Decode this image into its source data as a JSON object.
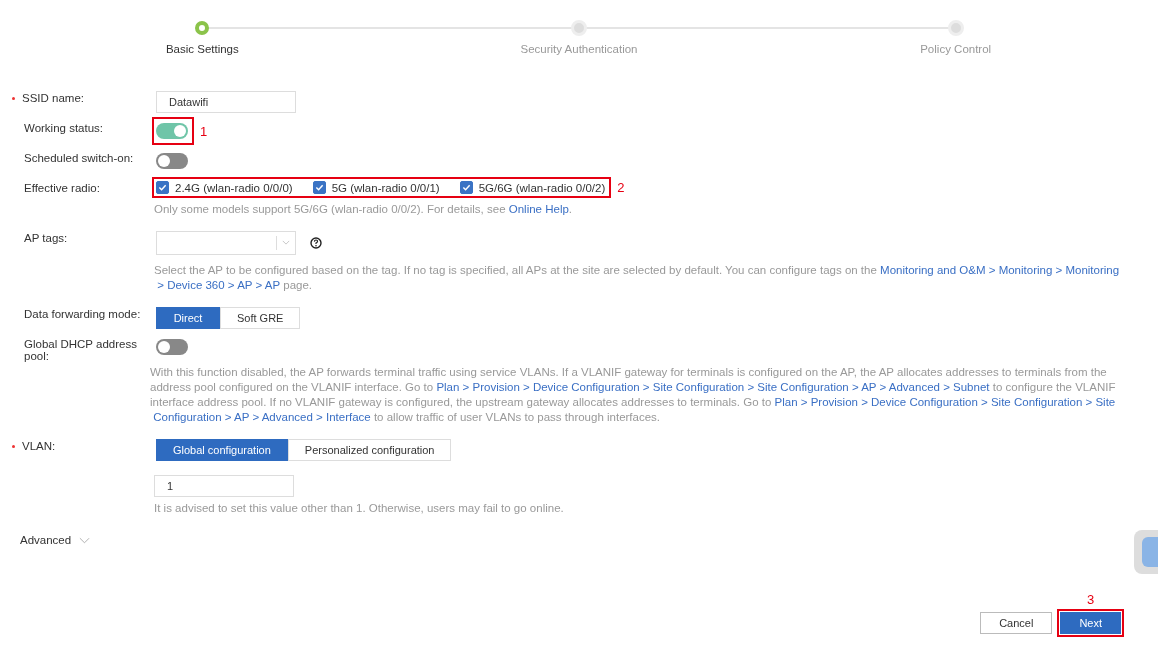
{
  "steps": [
    {
      "label": "Basic Settings",
      "selected": true
    },
    {
      "label": "Security Authentication",
      "selected": false
    },
    {
      "label": "Policy Control",
      "selected": false
    }
  ],
  "form": [
    {
      "kind": "text",
      "label": "SSID name:",
      "required": true,
      "value": "Datawifi"
    },
    {
      "kind": "toggle",
      "label": "Working status:",
      "required": false,
      "on": true,
      "annotation": "1"
    },
    {
      "kind": "toggle",
      "label": "Scheduled switch-on:",
      "required": false,
      "on": false
    },
    {
      "kind": "checks",
      "label": "Effective radio:",
      "required": false,
      "annotation": "2",
      "options": [
        {
          "label": "2.4G (wlan-radio 0/0/0)",
          "checked": true
        },
        {
          "label": "5G (wlan-radio 0/0/1)",
          "checked": true
        },
        {
          "label": "5G/6G (wlan-radio 0/0/2)",
          "checked": true
        }
      ],
      "help": [
        {
          "kind": "text",
          "text": "Only some models support 5G/6G (wlan-radio 0/0/2). For details, see "
        },
        {
          "kind": "link",
          "text": "Online Help"
        },
        {
          "kind": "text",
          "text": "."
        }
      ]
    },
    {
      "kind": "select",
      "label": "AP tags:",
      "required": false,
      "help": [
        {
          "kind": "text",
          "text": "Select the AP to be configured based on the tag. If no tag is specified, all APs at the site are selected by default. You can configure tags on the "
        },
        {
          "kind": "link",
          "text": "Monitoring and O&M > Monitoring > Monitoring"
        },
        {
          "kind": "link",
          "text": "> Device 360 > AP > AP",
          "spaced": true
        },
        {
          "kind": "text",
          "text": " page."
        }
      ]
    },
    {
      "kind": "segmented",
      "label": "Data forwarding mode:",
      "required": false,
      "options": [
        {
          "label": "Direct",
          "selected": true
        },
        {
          "label": "Soft GRE",
          "selected": false
        }
      ]
    },
    {
      "kind": "toggle",
      "label": "Global DHCP address pool:",
      "required": false,
      "on": false,
      "help": [
        {
          "kind": "text",
          "text": "With this function disabled, the AP forwards terminal traffic using service VLANs. If a VLANIF gateway for terminals is configured on the AP, the AP allocates addresses to terminals from the address pool configured on the VLANIF interface. Go to "
        },
        {
          "kind": "link",
          "text": "Plan > Provision > Device Configuration > Site Configuration"
        },
        {
          "kind": "link",
          "text": " > Site Configuration > AP > Advanced > Subnet"
        },
        {
          "kind": "text",
          "text": " to configure the VLANIF interface address pool. If no VLANIF gateway is configured, the upstream gateway allocates addresses to terminals. Go to "
        },
        {
          "kind": "link",
          "text": "Plan > Provision > Device Configuration > Site Configuration > Site"
        },
        {
          "kind": "link",
          "text": "Configuration > AP > Advanced > Interface",
          "spaced": true
        },
        {
          "kind": "text",
          "text": " to allow traffic of user VLANs to pass through interfaces."
        }
      ]
    },
    {
      "kind": "segmented",
      "label": "VLAN:",
      "required": true,
      "options": [
        {
          "label": "Global configuration",
          "selected": true
        },
        {
          "label": "Personalized configuration",
          "selected": false
        }
      ],
      "value": "1",
      "help": [
        {
          "kind": "text",
          "text": "It is advised to set this value other than 1. Otherwise, users may fail to go online."
        }
      ]
    }
  ],
  "advanced": {
    "label": "Advanced",
    "expanded": false
  },
  "buttons": [
    {
      "label": "Cancel",
      "kind": "secondary"
    },
    {
      "label": "Next",
      "kind": "primary",
      "annotation": "3"
    }
  ]
}
